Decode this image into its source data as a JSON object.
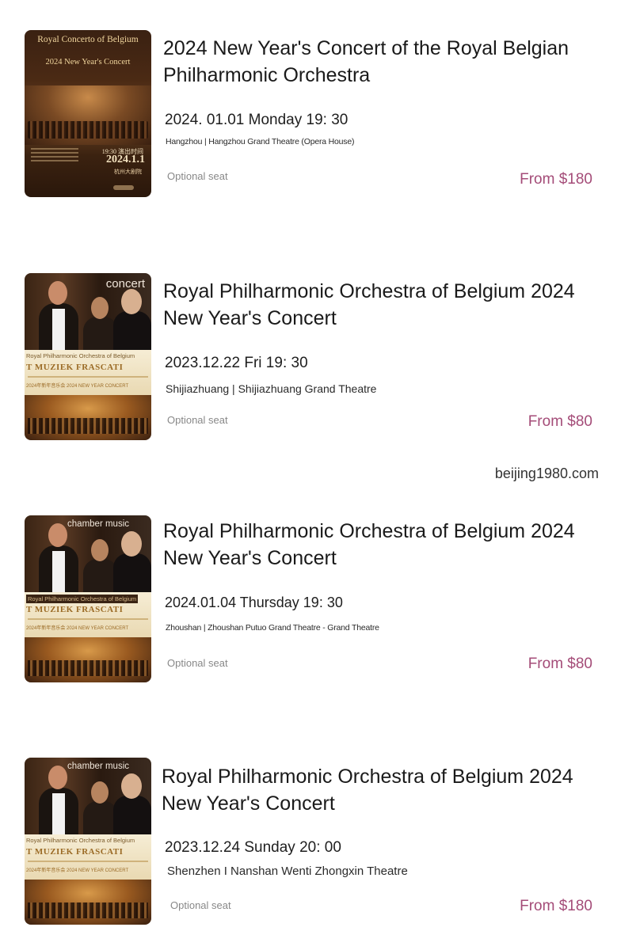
{
  "watermark": "beijing1980.com",
  "colors": {
    "price": "#a44c78",
    "seat": "#888888"
  },
  "events": [
    {
      "poster": {
        "style": "brown",
        "title": "Royal Concerto of Belgium",
        "subtitle": "2024 New Year's Concert",
        "date_small": "19:30 演出时间",
        "date_big": "2024.1.1",
        "venue": "杭州大剧院"
      },
      "title": "2024 New Year's Concert of the Royal Belgian Philharmonic Orchestra",
      "datetime": "2024. 01.01 Monday 19: 30",
      "venue": "Hangzhou | Hangzhou Grand Theatre (Opera House)",
      "seat": "Optional seat",
      "price": "From $180"
    },
    {
      "poster": {
        "tag": "concert",
        "band_line1": "Royal Philharmonic Orchestra of Belgium",
        "band_line2": "T MUZIEK FRASCATI",
        "band_line4": "2024年新年音乐会 2024 NEW YEAR CONCERT"
      },
      "title": "Royal Philharmonic Orchestra of Belgium 2024 New Year's Concert",
      "datetime": "2023.12.22 Fri 19: 30",
      "venue": "Shijiazhuang | Shijiazhuang Grand Theatre",
      "seat": "Optional seat",
      "price": "From $80"
    },
    {
      "poster": {
        "tag": "chamber music",
        "band_line1": "Royal Philharmonic Orchestra of Belgium",
        "band_line2": "T MUZIEK FRASCATI",
        "band_line4": "2024年新年音乐会 2024 NEW YEAR CONCERT"
      },
      "title": "Royal Philharmonic Orchestra of Belgium 2024 New Year's Concert",
      "datetime": "2024.01.04 Thursday 19: 30",
      "venue": "Zhoushan | Zhoushan Putuo Grand Theatre - Grand Theatre",
      "seat": "Optional seat",
      "price": "From $80"
    },
    {
      "poster": {
        "tag": "chamber music",
        "band_line1": "Royal Philharmonic Orchestra of Belgium",
        "band_line2": "T MUZIEK FRASCATI",
        "band_line4": "2024年新年音乐会 2024 NEW YEAR CONCERT"
      },
      "title": "Royal Philharmonic Orchestra of Belgium 2024 New Year's Concert",
      "datetime": "2023.12.24 Sunday 20: 00",
      "venue": "Shenzhen I Nanshan Wenti Zhongxin Theatre",
      "seat": "Optional seat",
      "price": "From $180"
    }
  ]
}
